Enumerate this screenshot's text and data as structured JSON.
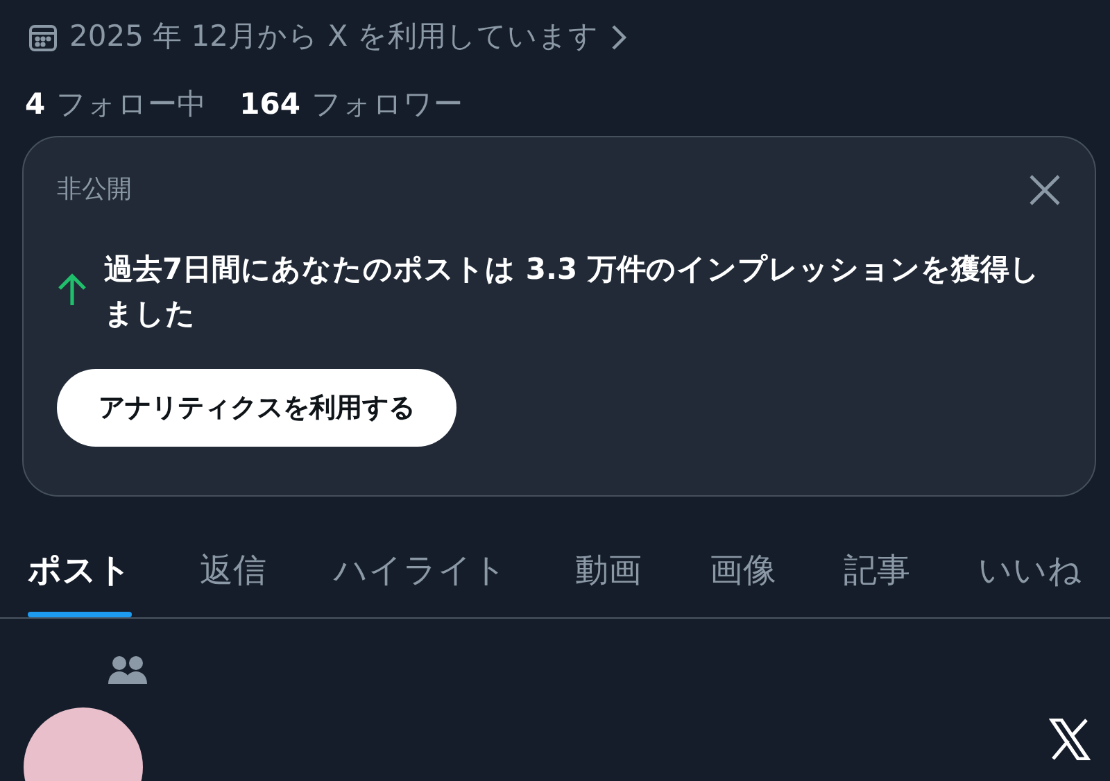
{
  "joined": {
    "text": "2025 年 12月から X を利用しています"
  },
  "stats": [
    {
      "count": "4",
      "label": "フォロー中"
    },
    {
      "count": "164",
      "label": "フォロワー"
    }
  ],
  "notice": {
    "tag": "非公開",
    "message": "過去7日間にあなたのポストは 3.3 万件のインプレッションを獲得しました",
    "button": "アナリティクスを利用する"
  },
  "tabs": [
    {
      "label": "ポスト",
      "selected": true
    },
    {
      "label": "返信",
      "selected": false
    },
    {
      "label": "ハイライト",
      "selected": false
    },
    {
      "label": "動画",
      "selected": false
    },
    {
      "label": "画像",
      "selected": false
    },
    {
      "label": "記事",
      "selected": false
    },
    {
      "label": "いいね",
      "selected": false
    }
  ]
}
